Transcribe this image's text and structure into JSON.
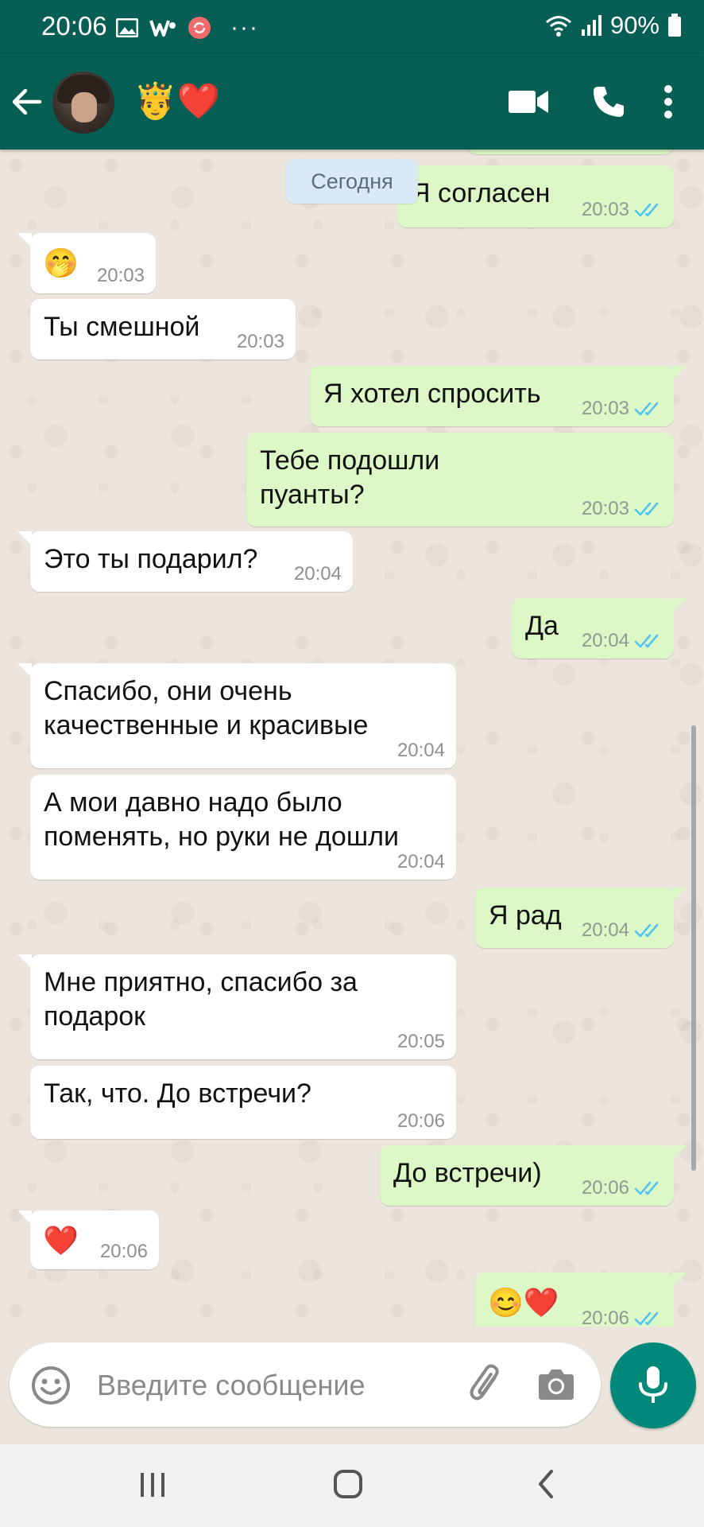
{
  "status_bar": {
    "time": "20:06",
    "battery": "90%",
    "icons": [
      "image-icon",
      "w-icon",
      "sync-icon",
      "more-dots-icon",
      "wifi-icon",
      "signal-icon",
      "battery-icon"
    ],
    "more": "···"
  },
  "header": {
    "contact_name": "🤴❤️",
    "icons": [
      "back-arrow-icon",
      "video-call-icon",
      "phone-icon",
      "menu-dots-icon"
    ]
  },
  "chat": {
    "date_chip": "Сегодня",
    "messages": [
      {
        "direction": "out",
        "text": "Я согласен",
        "time": "20:03",
        "read": true
      },
      {
        "direction": "in",
        "text": "🤭",
        "time": "20:03"
      },
      {
        "direction": "in",
        "text": "Ты смешной",
        "time": "20:03"
      },
      {
        "direction": "out",
        "text": "Я хотел спросить",
        "time": "20:03",
        "read": true
      },
      {
        "direction": "out",
        "line1": "Тебе подошли",
        "line2": "пуанты?",
        "time": "20:03",
        "read": true
      },
      {
        "direction": "in",
        "text": "Это ты подарил?",
        "time": "20:04"
      },
      {
        "direction": "out",
        "text": "Да",
        "time": "20:04",
        "read": true
      },
      {
        "direction": "in",
        "line1": "Спасибо, они очень",
        "line2": "качественные и красивые",
        "time": "20:04"
      },
      {
        "direction": "in",
        "line1": "А мои давно надо было",
        "line2": "поменять, но руки не дошли",
        "time": "20:04"
      },
      {
        "direction": "out",
        "text": "Я рад",
        "time": "20:04",
        "read": true
      },
      {
        "direction": "in",
        "line1": "Мне приятно, спасибо за",
        "line2": "подарок",
        "time": "20:05"
      },
      {
        "direction": "in",
        "text": "Так, что. До встречи?",
        "time": "20:06"
      },
      {
        "direction": "out",
        "text": "До встречи)",
        "time": "20:06",
        "read": true
      },
      {
        "direction": "in",
        "text": "❤️",
        "time": "20:06"
      },
      {
        "direction": "out",
        "text": "😊❤️",
        "time": "20:06",
        "read": true
      }
    ],
    "ticks_color": "#4fc3f7"
  },
  "composer": {
    "placeholder": "Введите сообщение",
    "icons": [
      "emoji-icon",
      "attach-icon",
      "camera-icon",
      "mic-icon"
    ]
  },
  "colors": {
    "header": "#075e54",
    "outgoing_bubble": "#dcf8c6",
    "incoming_bubble": "#ffffff",
    "chat_background": "#ece5dd",
    "accent": "#00897b"
  },
  "nav_bar": {
    "icons": [
      "recent-apps-icon",
      "home-icon",
      "back-icon"
    ]
  }
}
